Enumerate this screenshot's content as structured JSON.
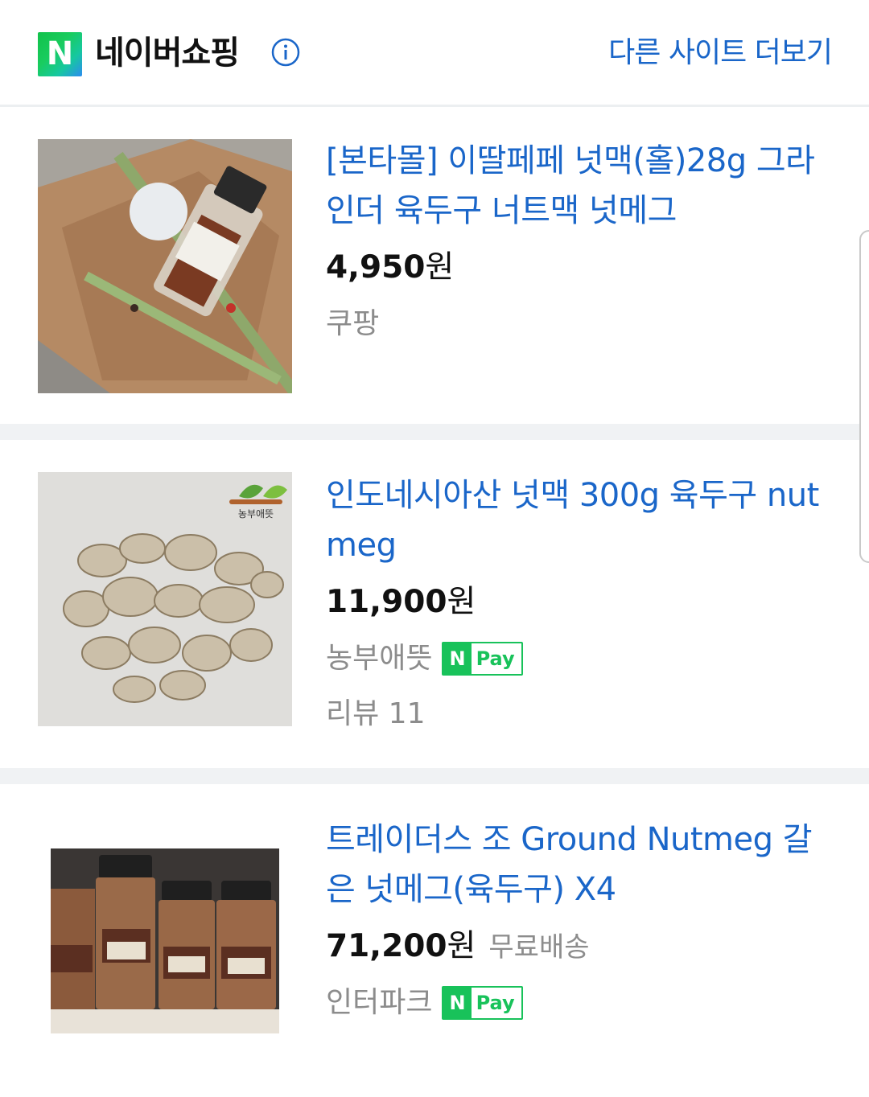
{
  "header": {
    "logo_letter": "N",
    "title": "네이버쇼핑",
    "info_icon": "info-circle-icon",
    "more_link": "다른 사이트 더보기"
  },
  "products": [
    {
      "title": "[본타몰] 이딸페페 넛맥(홀)28g 그라인더 육두구 너트맥 넛메그",
      "price": "4,950",
      "currency": "원",
      "mall": "쿠팡"
    },
    {
      "title": "인도네시아산 넛맥 300g 육두구 nutmeg",
      "price": "11,900",
      "currency": "원",
      "mall": "농부애뜻",
      "npay": {
        "n": "N",
        "text": "Pay"
      },
      "review": "리뷰 11",
      "thumb_badge": "농부애뜻"
    },
    {
      "title": "트레이더스 조 Ground Nutmeg 갈은 넛메그(육두구) X4",
      "price": "71,200",
      "currency": "원",
      "shipping": "무료배송",
      "mall": "인터파크",
      "npay": {
        "n": "N",
        "text": "Pay"
      }
    }
  ],
  "colors": {
    "link_blue": "#1a66c9",
    "npay_green": "#18c25a",
    "muted": "#8c8c8c"
  }
}
